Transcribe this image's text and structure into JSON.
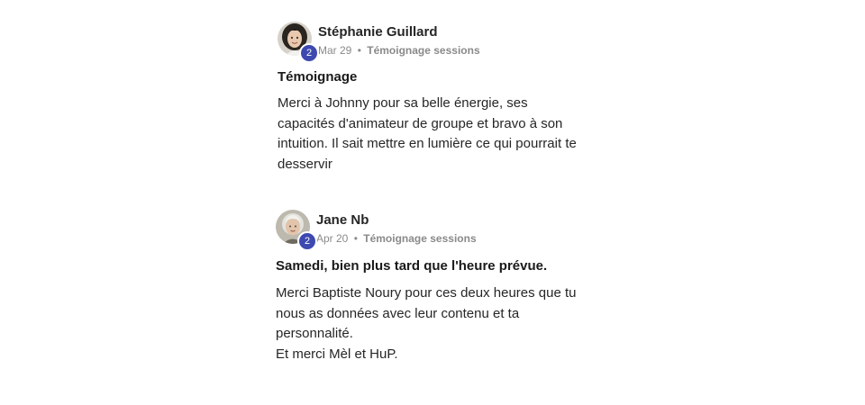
{
  "posts": [
    {
      "author": "Stéphanie Guillard",
      "level": "2",
      "date": "Mar 29",
      "separator": "•",
      "topic": "Témoignage sessions",
      "title": "Témoignage",
      "body": "Merci à Johnny pour sa belle énergie, ses\ncapacités d'animateur de groupe et bravo à son\nintuition. Il sait mettre en lumière ce qui pourrait te\ndesservir",
      "badge_color": "#3d49b0"
    },
    {
      "author": "Jane Nb",
      "level": "2",
      "date": "Apr 20",
      "separator": "•",
      "topic": "Témoignage sessions",
      "title": "Samedi, bien plus tard que l'heure prévue.",
      "body": "Merci Baptiste Noury pour ces deux heures que tu\nnous as données avec leur contenu et ta\npersonnalité.\nEt merci Mèl et HuP.",
      "badge_color": "#3d49b0"
    }
  ]
}
